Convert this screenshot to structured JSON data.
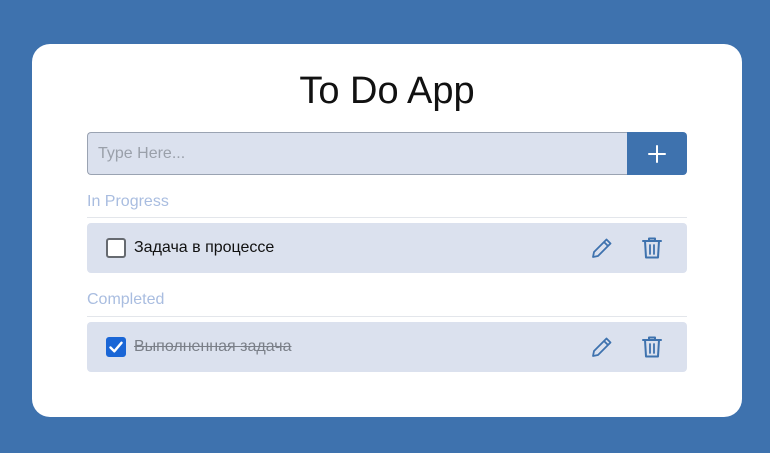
{
  "app": {
    "title": "To Do App"
  },
  "input": {
    "placeholder": "Type Here...",
    "value": ""
  },
  "sections": {
    "in_progress": {
      "label": "In Progress",
      "tasks": [
        {
          "text": "Задача в процессе",
          "completed": false
        }
      ]
    },
    "completed": {
      "label": "Completed",
      "tasks": [
        {
          "text": "Выполненная задача",
          "completed": true
        }
      ]
    }
  },
  "icons": {
    "add": "plus-icon",
    "edit": "pencil-icon",
    "delete": "trash-icon"
  },
  "colors": {
    "background": "#3e72ae",
    "accent": "#3e72ae",
    "row_bg": "#dbe1ee",
    "section_label": "#a9bde0",
    "checkbox_checked": "#1a66d6"
  }
}
